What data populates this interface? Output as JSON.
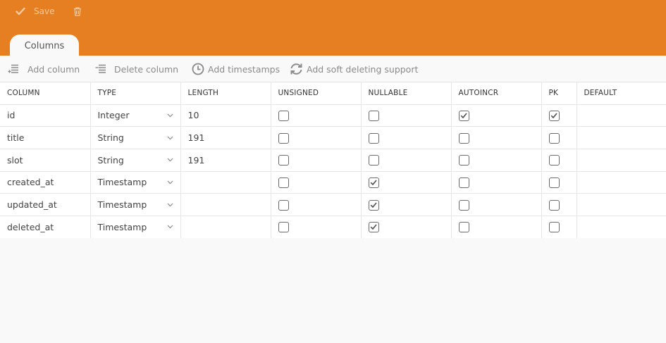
{
  "toolbar": {
    "save_label": "Save",
    "save_icon": "check-icon",
    "delete_icon": "trash-icon"
  },
  "tabs": [
    {
      "label": "Columns",
      "active": true
    }
  ],
  "actions": {
    "add_column": "Add column",
    "delete_column": "Delete column",
    "add_timestamps": "Add timestamps",
    "add_soft_deleting": "Add soft deleting support"
  },
  "columns_table": {
    "headers": [
      "COLUMN",
      "TYPE",
      "LENGTH",
      "UNSIGNED",
      "NULLABLE",
      "AUTOINCR",
      "PK",
      "DEFAULT"
    ],
    "rows": [
      {
        "column": "id",
        "type": "Integer",
        "length": "10",
        "unsigned": false,
        "nullable": false,
        "autoincr": true,
        "pk": true,
        "default": ""
      },
      {
        "column": "title",
        "type": "String",
        "length": "191",
        "unsigned": false,
        "nullable": false,
        "autoincr": false,
        "pk": false,
        "default": ""
      },
      {
        "column": "slot",
        "type": "String",
        "length": "191",
        "unsigned": false,
        "nullable": false,
        "autoincr": false,
        "pk": false,
        "default": ""
      },
      {
        "column": "created_at",
        "type": "Timestamp",
        "length": "",
        "unsigned": false,
        "nullable": true,
        "autoincr": false,
        "pk": false,
        "default": ""
      },
      {
        "column": "updated_at",
        "type": "Timestamp",
        "length": "",
        "unsigned": false,
        "nullable": true,
        "autoincr": false,
        "pk": false,
        "default": ""
      },
      {
        "column": "deleted_at",
        "type": "Timestamp",
        "length": "",
        "unsigned": false,
        "nullable": true,
        "autoincr": false,
        "pk": false,
        "default": ""
      }
    ]
  },
  "colors": {
    "header_bar": "#e67e22",
    "header_icon": "#f7c99f",
    "toolbar_text": "#8a8a8a"
  }
}
